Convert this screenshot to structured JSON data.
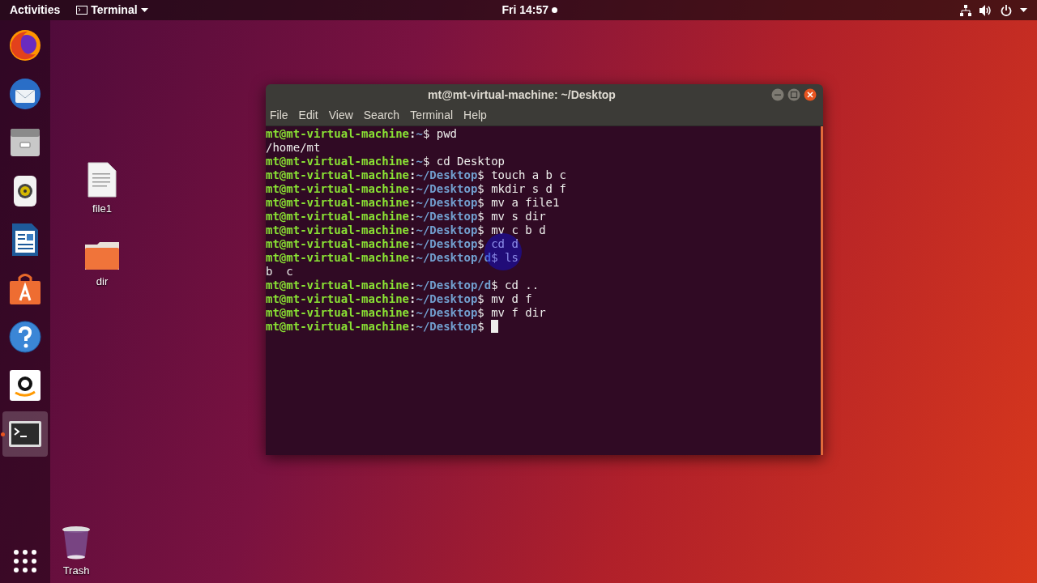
{
  "top_bar": {
    "activities": "Activities",
    "app_menu": "Terminal",
    "clock": "Fri 14:57",
    "notification": true
  },
  "dock": {
    "items": [
      {
        "kind": "browser",
        "selected": false,
        "running": false
      },
      {
        "kind": "mail",
        "selected": false,
        "running": false
      },
      {
        "kind": "files",
        "selected": false,
        "running": false
      },
      {
        "kind": "music",
        "selected": false,
        "running": false
      },
      {
        "kind": "writer",
        "selected": false,
        "running": false
      },
      {
        "kind": "store",
        "selected": false,
        "running": false
      },
      {
        "kind": "help",
        "selected": false,
        "running": false
      },
      {
        "kind": "amazon",
        "selected": false,
        "running": false
      },
      {
        "kind": "terminal",
        "selected": true,
        "running": true
      }
    ]
  },
  "desktop_icons": [
    {
      "kind": "file",
      "label": "file1"
    },
    {
      "kind": "folder",
      "label": "dir"
    },
    {
      "kind": "trash",
      "label": "Trash"
    }
  ],
  "window": {
    "title": "mt@mt-virtual-machine: ~/Desktop",
    "menu": [
      "File",
      "Edit",
      "View",
      "Search",
      "Terminal",
      "Help"
    ],
    "lines": [
      {
        "kind": "prompt",
        "user": "mt@mt-virtual-machine",
        "sep": ":",
        "path": "~",
        "symbol": "$",
        "command": "pwd",
        "cursor": false
      },
      {
        "kind": "output",
        "text": "/home/mt"
      },
      {
        "kind": "prompt",
        "user": "mt@mt-virtual-machine",
        "sep": ":",
        "path": "~",
        "symbol": "$",
        "command": "cd Desktop",
        "cursor": false
      },
      {
        "kind": "prompt",
        "user": "mt@mt-virtual-machine",
        "sep": ":",
        "path": "~/Desktop",
        "symbol": "$",
        "command": "touch a b c",
        "cursor": false
      },
      {
        "kind": "prompt",
        "user": "mt@mt-virtual-machine",
        "sep": ":",
        "path": "~/Desktop",
        "symbol": "$",
        "command": "mkdir s d f",
        "cursor": false
      },
      {
        "kind": "prompt",
        "user": "mt@mt-virtual-machine",
        "sep": ":",
        "path": "~/Desktop",
        "symbol": "$",
        "command": "mv a file1",
        "cursor": false
      },
      {
        "kind": "prompt",
        "user": "mt@mt-virtual-machine",
        "sep": ":",
        "path": "~/Desktop",
        "symbol": "$",
        "command": "mv s dir",
        "cursor": false
      },
      {
        "kind": "prompt",
        "user": "mt@mt-virtual-machine",
        "sep": ":",
        "path": "~/Desktop",
        "symbol": "$",
        "command": "mv c b d",
        "cursor": false
      },
      {
        "kind": "prompt",
        "user": "mt@mt-virtual-machine",
        "sep": ":",
        "path": "~/Desktop",
        "symbol": "$",
        "command": "cd d",
        "cursor": false
      },
      {
        "kind": "prompt",
        "user": "mt@mt-virtual-machine",
        "sep": ":",
        "path": "~/Desktop/d",
        "symbol": "$",
        "command": "ls",
        "cursor": false
      },
      {
        "kind": "output",
        "text": "b  c"
      },
      {
        "kind": "prompt",
        "user": "mt@mt-virtual-machine",
        "sep": ":",
        "path": "~/Desktop/d",
        "symbol": "$",
        "command": "cd ..",
        "cursor": false
      },
      {
        "kind": "prompt",
        "user": "mt@mt-virtual-machine",
        "sep": ":",
        "path": "~/Desktop",
        "symbol": "$",
        "command": "mv d f",
        "cursor": false
      },
      {
        "kind": "prompt",
        "user": "mt@mt-virtual-machine",
        "sep": ":",
        "path": "~/Desktop",
        "symbol": "$",
        "command": "mv f dir",
        "cursor": false
      },
      {
        "kind": "prompt",
        "user": "mt@mt-virtual-machine",
        "sep": ":",
        "path": "~/Desktop",
        "symbol": "$",
        "cursor": true
      }
    ]
  }
}
